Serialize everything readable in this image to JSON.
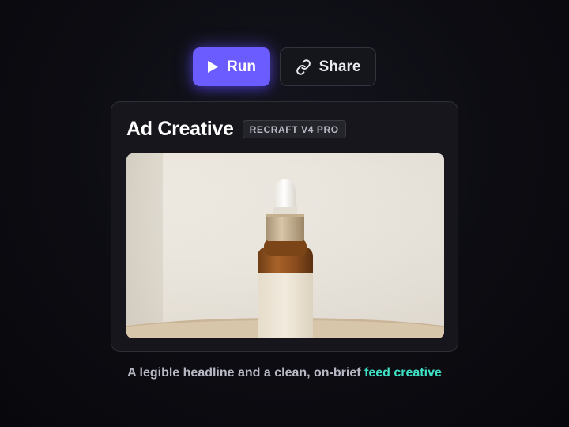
{
  "toolbar": {
    "run_label": "Run",
    "share_label": "Share",
    "run_icon": "play-icon",
    "share_icon": "link-icon"
  },
  "card": {
    "title": "Ad Creative",
    "badge": "RECRAFT V4 PRO",
    "image_subject": "amber dropper bottle with cream label on a tray"
  },
  "caption": {
    "text": "A legible headline and a clean, on-brief",
    "highlight": "feed creative"
  },
  "colors": {
    "accent": "#6b5cff",
    "highlight": "#3fe0c5",
    "background": "#0c0c12",
    "card": "#16161c"
  }
}
